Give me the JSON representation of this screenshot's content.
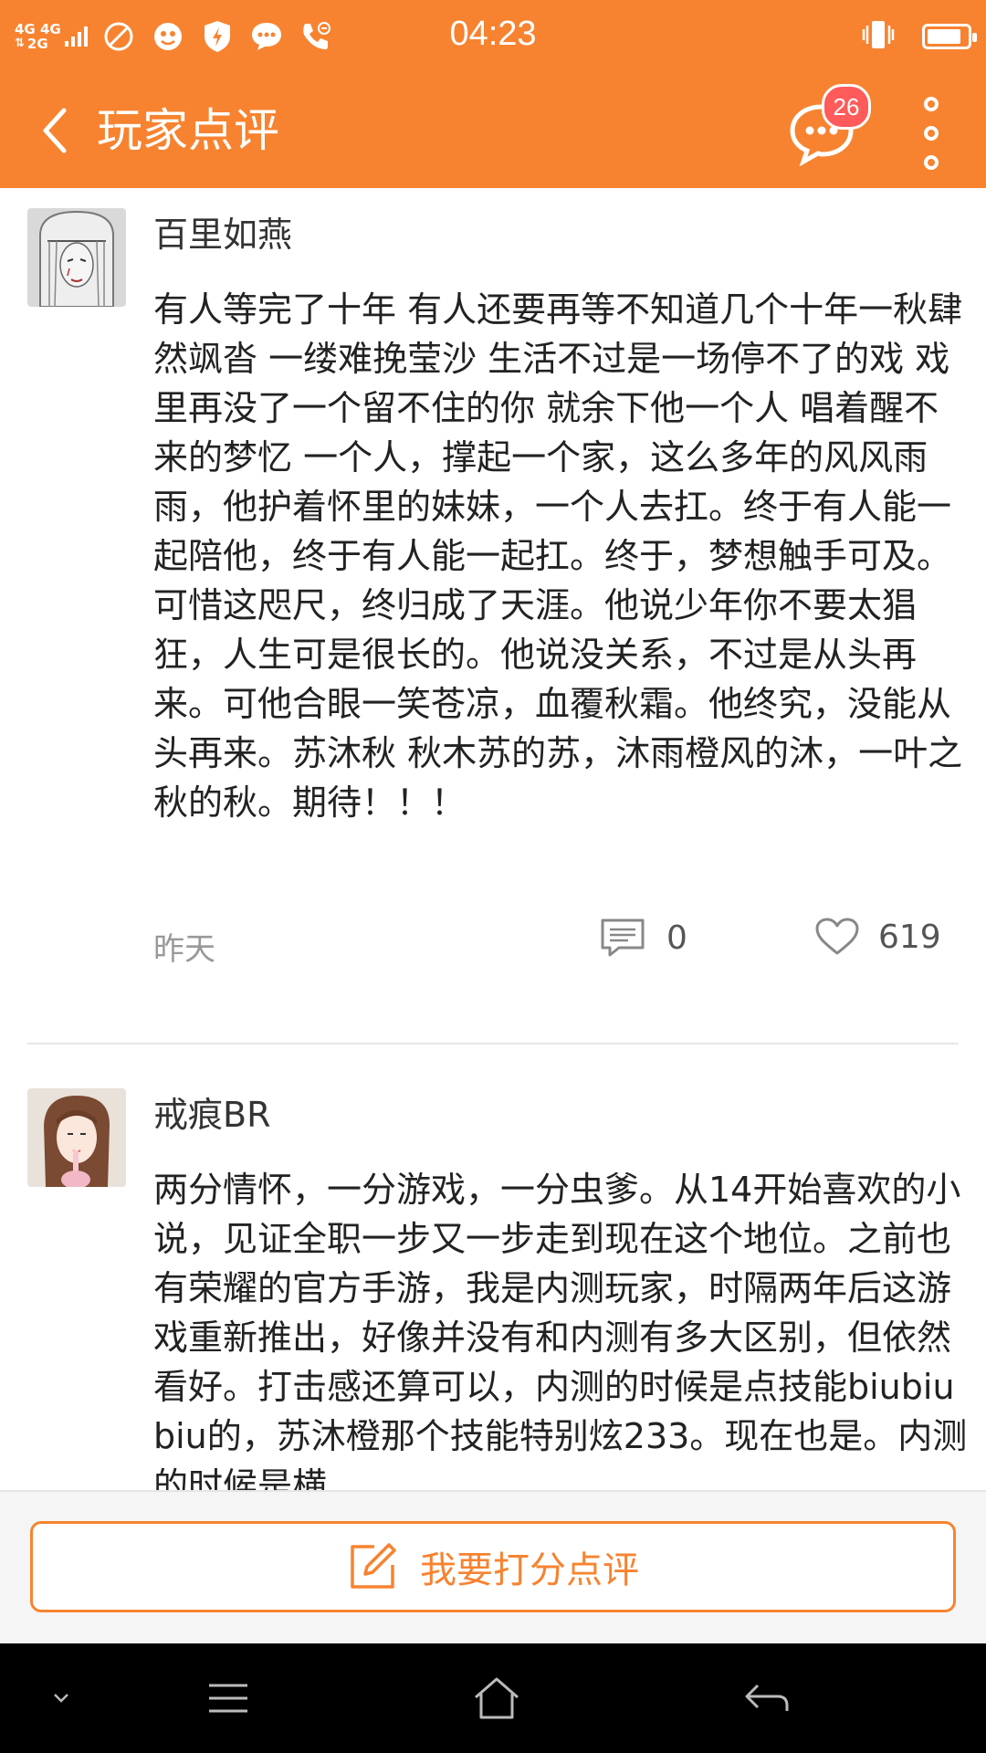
{
  "status": {
    "network_a": "4G 4G",
    "network_b": "2G",
    "time": "04:23",
    "battery_level": 0.85
  },
  "header": {
    "title": "玩家点评",
    "back_icon": "back-arrow-icon",
    "messages_badge": "26",
    "colors": {
      "brand": "#f78330",
      "badge": "#ff5b5b"
    }
  },
  "reviews": [
    {
      "username": "百里如燕",
      "content": "有人等完了十年 有人还要再等不知道几个十年一秋肆然飒沓 一缕难挽莹沙 生活不过是一场停不了的戏 戏里再没了一个留不住的你 就余下他一个人 唱着醒不来的梦忆 一个人，撑起一个家，这么多年的风风雨雨，他护着怀里的妹妹，一个人去扛。终于有人能一起陪他，终于有人能一起扛。终于，梦想触手可及。可惜这咫尺，终归成了天涯。他说少年你不要太猖狂，人生可是很长的。他说没关系，不过是从头再来。可他合眼一笑苍凉，血覆秋霜。他终究，没能从头再来。苏沐秋 秋木苏的苏，沐雨橙风的沐，一叶之秋的秋。期待！！！",
      "date": "昨天",
      "comments": "0",
      "likes": "619"
    },
    {
      "username": "戒痕BR",
      "content": "两分情怀，一分游戏，一分虫爹。从14开始喜欢的小说，见证全职一步又一步走到现在这个地位。之前也有荣耀的官方手游，我是内测玩家，时隔两年后这游戏重新推出，好像并没有和内测有多大区别，但依然看好。打击感还算可以，内测的时候是点技能biubiubiu的，苏沐橙那个技能特别炫233。现在也是。内测的时候是横"
    }
  ],
  "bottom": {
    "rate_button": "我要打分点评"
  }
}
